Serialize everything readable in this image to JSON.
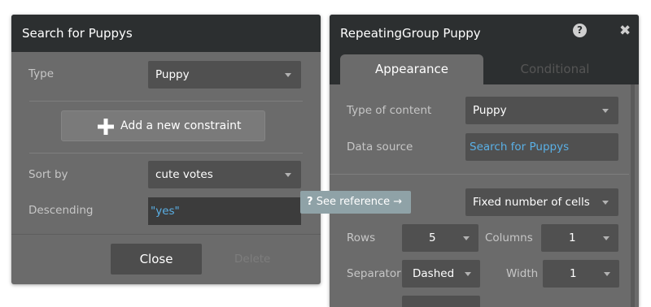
{
  "left_panel": {
    "title": "Search for Puppys",
    "type_label": "Type",
    "type_value": "Puppy",
    "add_constraint_label": "Add a new constraint",
    "sort_by_label": "Sort by",
    "sort_by_value": "cute votes",
    "descending_label": "Descending",
    "descending_value": "\"yes\"",
    "close_label": "Close",
    "delete_label": "Delete"
  },
  "tooltip": {
    "icon": "?",
    "text": "See reference →"
  },
  "right_panel": {
    "title": "RepeatingGroup Puppy",
    "help_icon": "?",
    "close_icon": "✖",
    "tabs": [
      "Appearance",
      "Conditional"
    ],
    "type_of_content_label": "Type of content",
    "type_of_content_value": "Puppy",
    "data_source_label": "Data source",
    "data_source_value": "Search for Puppys",
    "layout_value": "Fixed number of cells",
    "rows_label": "Rows",
    "rows_value": "5",
    "columns_label": "Columns",
    "columns_value": "1",
    "separator_label": "Separator",
    "separator_value": "Dashed",
    "width_label": "Width",
    "width_value": "1"
  },
  "colors": {
    "header": "#2c2f30",
    "panel": "#6b6b6b",
    "field": "#505050",
    "link": "#5ab0e6",
    "tooltip": "#8fa2a7"
  }
}
